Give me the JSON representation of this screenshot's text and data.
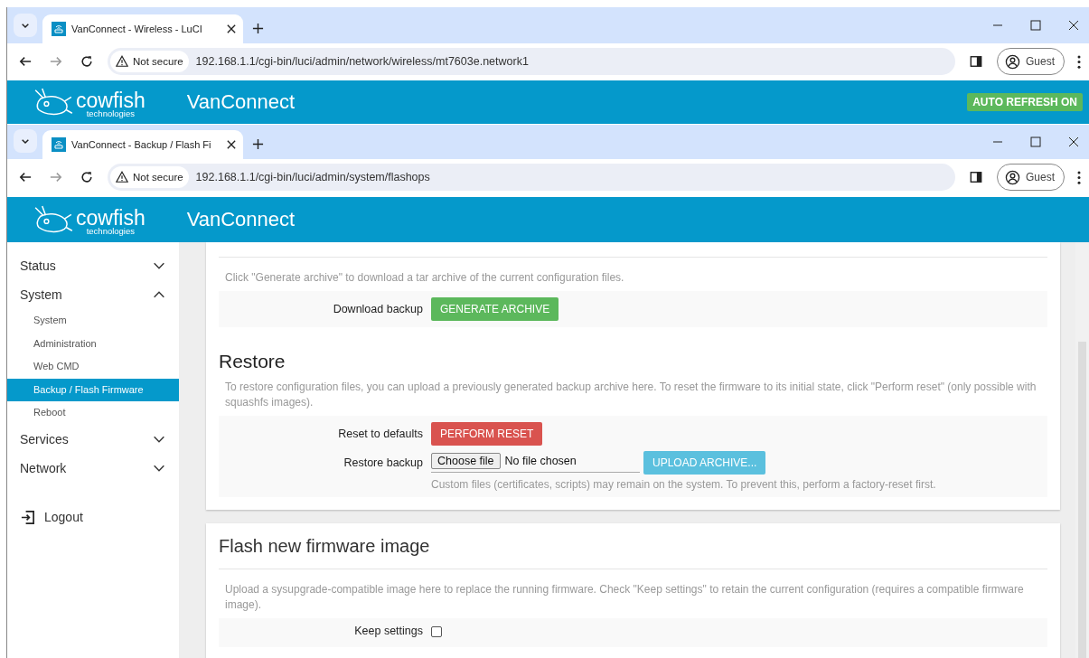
{
  "windows": [
    {
      "tab": {
        "title": "VanConnect - Wireless - LuCI"
      },
      "address": {
        "security": "Not secure",
        "url": "192.168.1.1/cgi-bin/luci/admin/network/wireless/mt7603e.network1"
      },
      "profile": "Guest",
      "header": {
        "brand": "cowfish",
        "brand_sub": "technologies",
        "title": "VanConnect",
        "badge": "AUTO REFRESH ON"
      }
    },
    {
      "tab": {
        "title": "VanConnect - Backup / Flash Fi"
      },
      "address": {
        "security": "Not secure",
        "url": "192.168.1.1/cgi-bin/luci/admin/system/flashops"
      },
      "profile": "Guest",
      "header": {
        "brand": "cowfish",
        "brand_sub": "technologies",
        "title": "VanConnect"
      },
      "sidebar": {
        "items": [
          {
            "label": "Status",
            "expanded": false
          },
          {
            "label": "System",
            "expanded": true,
            "children": [
              {
                "label": "System",
                "selected": false
              },
              {
                "label": "Administration",
                "selected": false
              },
              {
                "label": "Web CMD",
                "selected": false
              },
              {
                "label": "Backup / Flash Firmware",
                "selected": true
              },
              {
                "label": "Reboot",
                "selected": false
              }
            ]
          },
          {
            "label": "Services",
            "expanded": false
          },
          {
            "label": "Network",
            "expanded": false
          }
        ],
        "logout": "Logout"
      },
      "cards": [
        {
          "sections": [
            {
              "description": "Click \"Generate archive\" to download a tar archive of the current configuration files.",
              "rows": [
                {
                  "kind": "button",
                  "label": "Download backup",
                  "button": {
                    "label": "GENERATE ARCHIVE"
                  }
                }
              ]
            },
            {
              "title": "Restore",
              "description": "To restore configuration files, you can upload a previously generated backup archive here. To reset the firmware to its initial state, click \"Perform reset\" (only possible with squashfs images).",
              "rows": [
                {
                  "kind": "button",
                  "label": "Reset to defaults",
                  "button": {
                    "label": "PERFORM RESET"
                  }
                },
                {
                  "kind": "file",
                  "label": "Restore backup",
                  "choose": "Choose file",
                  "status": "No file chosen",
                  "button": {
                    "label": "UPLOAD ARCHIVE..."
                  },
                  "hint": "Custom files (certificates, scripts) may remain on the system. To prevent this, perform a factory-reset first."
                }
              ]
            }
          ]
        },
        {
          "title": "Flash new firmware image",
          "sections": [
            {
              "description": "Upload a sysupgrade-compatible image here to replace the running firmware. Check \"Keep settings\" to retain the current configuration (requires a compatible firmware image).",
              "rows": [
                {
                  "kind": "checkbox",
                  "label": "Keep settings",
                  "checked": false
                }
              ]
            }
          ]
        }
      ]
    }
  ]
}
